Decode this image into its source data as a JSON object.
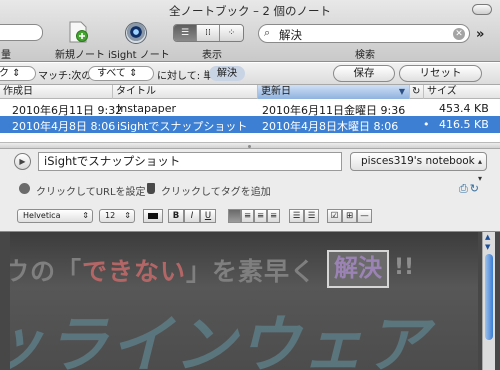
{
  "window": {
    "title": "全ノートブック – 2 個のノート"
  },
  "toolbar": {
    "left_label": "量",
    "new_note_label": "新規ノート",
    "isight_label": "iSight ノート",
    "view_label": "表示",
    "view_modes": [
      "☰",
      "⁞⁞",
      "⁘"
    ],
    "search_value": "解決",
    "search_label": "検索"
  },
  "scope_bar": {
    "scope_suffix": "ク",
    "match_pop": "マッチ:次の",
    "all_pop": "すべて",
    "target_text": "に対して: 単語",
    "term_chip": "解決",
    "save_button": "保存",
    "reset_button": "リセット"
  },
  "note_list": {
    "columns": [
      {
        "label": "作成日"
      },
      {
        "label": "タイトル"
      },
      {
        "label": "更新日"
      },
      {
        "label": "サイズ"
      }
    ],
    "rows": [
      {
        "created": "2010年6月11日 9:32",
        "title": "Instapaper",
        "updated": "2010年6月11日金曜日 9:36",
        "size": "453.4 KB"
      },
      {
        "created": "2010年4月8日 8:06",
        "title": "iSightでスナップショット",
        "updated": "2010年4月8日木曜日 8:06",
        "size": "416.5 KB"
      }
    ]
  },
  "editor": {
    "note_title": "iSightでスナップショット",
    "notebook": "pisces319's notebook",
    "set_url_text": "クリックしてURLを設定",
    "add_tag_text": "クリックしてタグを追加",
    "font_name": "Helvetica",
    "font_size": "12",
    "bold": "B",
    "italic": "I",
    "underline": "U"
  },
  "note_content": {
    "line1_start": "ウの「",
    "line1_red": "できない",
    "line1_mid": "」を素早く",
    "highlight": "解決",
    "line1_end": "!!",
    "line2": "ッラインウェア"
  },
  "colors": {
    "selection": "#3d7fd2",
    "sorted_header": "#8fb2dd",
    "note_background": "#474747"
  }
}
